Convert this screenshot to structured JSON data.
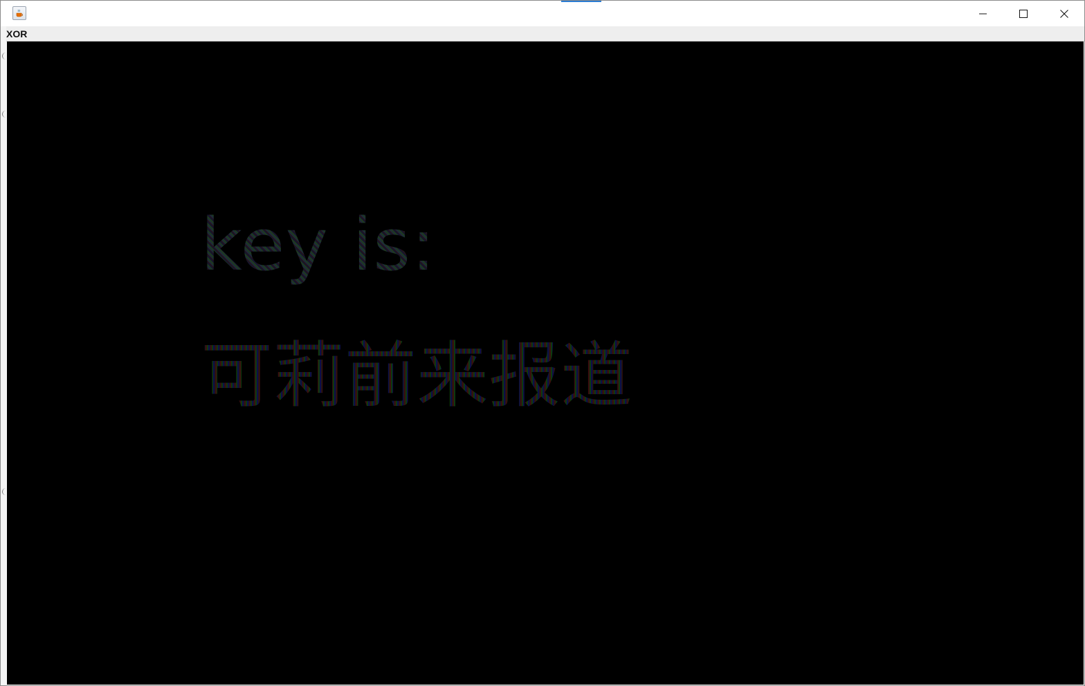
{
  "window": {
    "icon": "java-cup-icon",
    "accent_color": "#2b7cd3",
    "controls": {
      "minimize": "minimize-icon",
      "maximize": "maximize-icon",
      "close": "close-icon"
    }
  },
  "menubar": {
    "items": [
      {
        "label": "XOR"
      }
    ]
  },
  "canvas": {
    "background_color": "#000000",
    "line1": "key is:",
    "line2": "可莉前来报道"
  }
}
